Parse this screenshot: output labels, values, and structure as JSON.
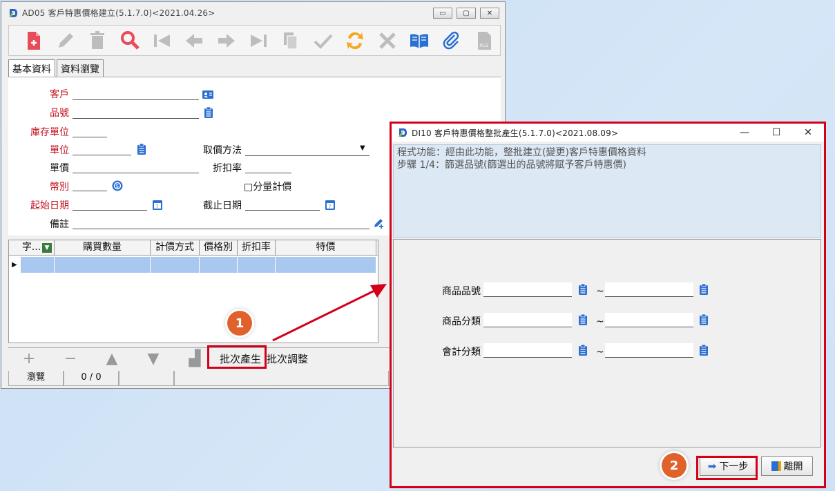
{
  "win1": {
    "title": "AD05 客戶特惠價格建立(5.1.7.0)<2021.04.26>",
    "controls": [
      "▭",
      "▢",
      "✕"
    ],
    "toolbar_icons": [
      "new-doc-icon",
      "edit-pencil-icon",
      "delete-trash-icon",
      "search-magnifier-icon",
      "first-record-icon",
      "previous-record-icon",
      "next-record-icon",
      "last-record-icon",
      "copy-icon",
      "confirm-check-icon",
      "refresh-icon",
      "cancel-x-icon",
      "book-icon",
      "attachment-icon",
      "xls-export-icon"
    ],
    "tabs": [
      "基本資料",
      "資料瀏覽"
    ],
    "form": {
      "customer": "客戶",
      "item_no": "品號",
      "stock_unit": "庫存單位",
      "unit": "單位",
      "pricing_method": "取價方法",
      "unit_price": "單價",
      "discount_rate": "折扣率",
      "currency": "幣別",
      "qty_pricing": "□分量計價",
      "start_date": "起始日期",
      "end_date": "截止日期",
      "remark": "備註"
    },
    "grid_headers": [
      "字...",
      "購買數量",
      "計價方式",
      "價格別",
      "折扣率",
      "特價"
    ],
    "bottom_icons": [
      "+",
      "−",
      "▲",
      "▼",
      "▟"
    ],
    "batch_create": "批次產生",
    "batch_adjust": "批次調整",
    "status_mode": "瀏覽",
    "status_count": "0 / 0"
  },
  "win2": {
    "title": "DI10 客戶特惠價格整批產生(5.1.7.0)<2021.08.09>",
    "controls": [
      "—",
      "☐",
      "✕"
    ],
    "desc_line1": "程式功能：經由此功能，整批建立(變更)客戶特惠價格資料",
    "desc_line2": "步驟 1/4：篩選品號(篩選出的品號將賦予客戶特惠價)",
    "field_labels": [
      "商品品號",
      "商品分類",
      "會計分類"
    ],
    "tilde": "~",
    "next_label": "下一步",
    "leave_label": "離開"
  },
  "callouts": [
    "1",
    "2"
  ],
  "colors": {
    "required_label": "#c1121f",
    "highlight_box": "#d4001a",
    "callout_bg": "#e0612a",
    "grid_row": "#a8c8ef",
    "desc_bg": "#dde8f5"
  }
}
